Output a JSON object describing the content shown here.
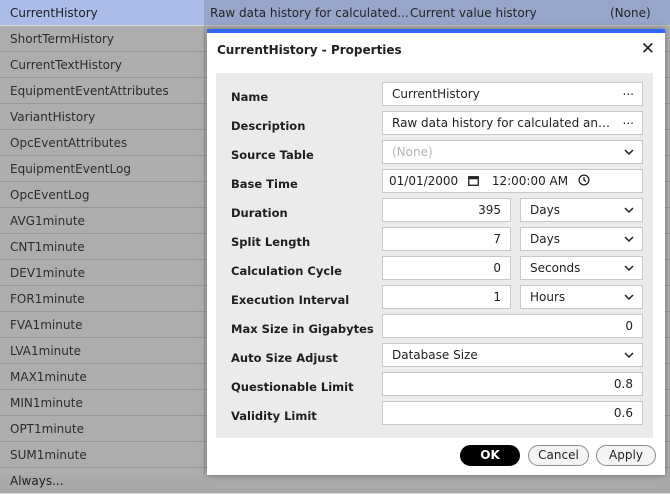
{
  "background_list": {
    "rows": [
      {
        "name": "CurrentHistory",
        "description": "Raw data history for calculated...",
        "value_type": "Current value history",
        "extra": "(None)"
      },
      {
        "name": "ShortTermHistory"
      },
      {
        "name": "CurrentTextHistory"
      },
      {
        "name": "EquipmentEventAttributes"
      },
      {
        "name": "VariantHistory"
      },
      {
        "name": "OpcEventAttributes"
      },
      {
        "name": "EquipmentEventLog"
      },
      {
        "name": "OpcEventLog"
      },
      {
        "name": "AVG1minute"
      },
      {
        "name": "CNT1minute"
      },
      {
        "name": "DEV1minute"
      },
      {
        "name": "FOR1minute"
      },
      {
        "name": "FVA1minute"
      },
      {
        "name": "LVA1minute"
      },
      {
        "name": "MAX1minute"
      },
      {
        "name": "MIN1minute"
      },
      {
        "name": "OPT1minute"
      },
      {
        "name": "SUM1minute"
      },
      {
        "name": "Always..."
      }
    ]
  },
  "dialog": {
    "title": "CurrentHistory - Properties",
    "close_icon": "close-icon",
    "fields": {
      "name": {
        "label": "Name",
        "value": "CurrentHistory",
        "button": "..."
      },
      "description": {
        "label": "Description",
        "value": "Raw data history for calculated and ...",
        "button": "..."
      },
      "source_table": {
        "label": "Source Table",
        "value": "(None)"
      },
      "base_time": {
        "label": "Base Time",
        "date": "01/01/2000",
        "time": "12:00:00 AM"
      },
      "duration": {
        "label": "Duration",
        "value": "395",
        "unit": "Days"
      },
      "split_length": {
        "label": "Split Length",
        "value": "7",
        "unit": "Days"
      },
      "calculation_cycle": {
        "label": "Calculation Cycle",
        "value": "0",
        "unit": "Seconds"
      },
      "execution_interval": {
        "label": "Execution Interval",
        "value": "1",
        "unit": "Hours"
      },
      "max_size": {
        "label": "Max Size in Gigabytes",
        "value": "0"
      },
      "auto_size_adjust": {
        "label": "Auto Size Adjust",
        "value": "Database Size"
      },
      "questionable_limit": {
        "label": "Questionable Limit",
        "value": "0.8"
      },
      "validity_limit": {
        "label": "Validity Limit",
        "value": "0.6"
      }
    },
    "buttons": {
      "ok": "OK",
      "cancel": "Cancel",
      "apply": "Apply"
    }
  },
  "colors": {
    "accent": "#3366ff",
    "selection": "#a9bde8"
  }
}
